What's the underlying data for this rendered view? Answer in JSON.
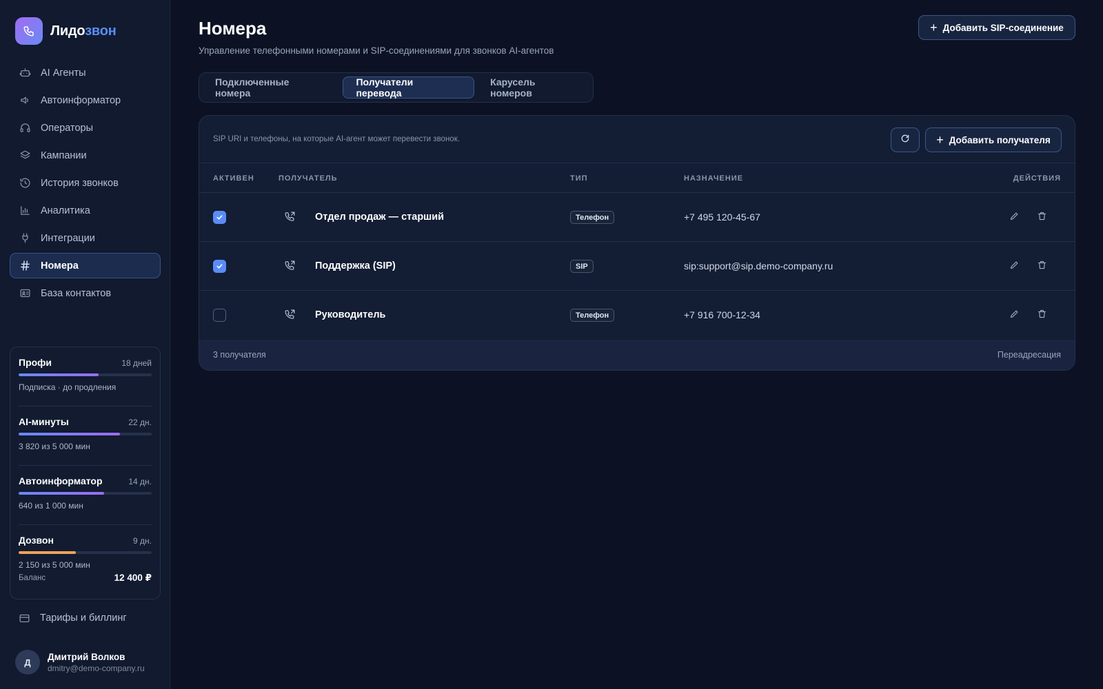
{
  "brand": {
    "name_part1": "Лидо",
    "name_part2": "звон"
  },
  "sidebar": {
    "items": [
      {
        "label": "AI Агенты",
        "icon": "robot-icon"
      },
      {
        "label": "Автоинформатор",
        "icon": "speaker-icon"
      },
      {
        "label": "Операторы",
        "icon": "headset-icon"
      },
      {
        "label": "Кампании",
        "icon": "layers-icon"
      },
      {
        "label": "История звонков",
        "icon": "history-icon"
      },
      {
        "label": "Аналитика",
        "icon": "chart-icon"
      },
      {
        "label": "Интеграции",
        "icon": "plug-icon"
      },
      {
        "label": "Номера",
        "icon": "hash-icon",
        "active": true
      },
      {
        "label": "База контактов",
        "icon": "contact-card-icon"
      }
    ],
    "billing_label": "Тарифы и биллинг"
  },
  "usage": {
    "plan": {
      "title": "Профи",
      "days": "18 дней",
      "sub": "Подписка · до продления",
      "progress": 0.6
    },
    "ai_minutes": {
      "title": "AI-минуты",
      "days": "22 дн.",
      "sub": "3 820 из 5 000 мин",
      "progress": 0.764
    },
    "autoinformer": {
      "title": "Автоинформатор",
      "days": "14 дн.",
      "sub": "640 из 1 000 мин",
      "progress": 0.64
    },
    "dialer": {
      "title": "Дозвон",
      "days": "9 дн.",
      "sub": "2 150 из 5 000 мин",
      "progress": 0.43
    },
    "balance_label": "Баланс",
    "balance_value": "12 400 ₽"
  },
  "user": {
    "initial": "Д",
    "name": "Дмитрий Волков",
    "email": "dmitry@demo-company.ru"
  },
  "header": {
    "title": "Номера",
    "subtitle": "Управление телефонными номерами и SIP-соединениями для звонков AI-агентов",
    "add_sip_label": "Добавить SIP-соединение"
  },
  "tabs": [
    {
      "label": "Подключенные номера"
    },
    {
      "label": "Получатели перевода",
      "active": true
    },
    {
      "label": "Карусель номеров"
    }
  ],
  "panel": {
    "description": "SIP URI и телефоны, на которые AI-агент может перевести звонок.",
    "add_recipient_label": "Добавить получателя",
    "columns": {
      "active": "АКТИВЕН",
      "recipient": "ПОЛУЧАТЕЛЬ",
      "type": "ТИП",
      "destination": "НАЗНАЧЕНИЕ",
      "actions": "ДЕЙСТВИЯ"
    },
    "rows": [
      {
        "active": true,
        "name": "Отдел продаж — старший",
        "type": "Телефон",
        "destination": "+7 495 120-45-67"
      },
      {
        "active": true,
        "name": "Поддержка (SIP)",
        "type": "SIP",
        "destination": "sip:support@sip.demo-company.ru"
      },
      {
        "active": false,
        "name": "Руководитель",
        "type": "Телефон",
        "destination": "+7 916 700-12-34"
      }
    ],
    "footer_count": "3 получателя",
    "footer_right": "Переадресация"
  },
  "colors": {
    "accent": "#5b8cf6",
    "bar_blue": "#6a8af4",
    "bar_purple": "#9b6cf2",
    "bar_orange": "#f2a25a",
    "background": "#0c1224"
  }
}
